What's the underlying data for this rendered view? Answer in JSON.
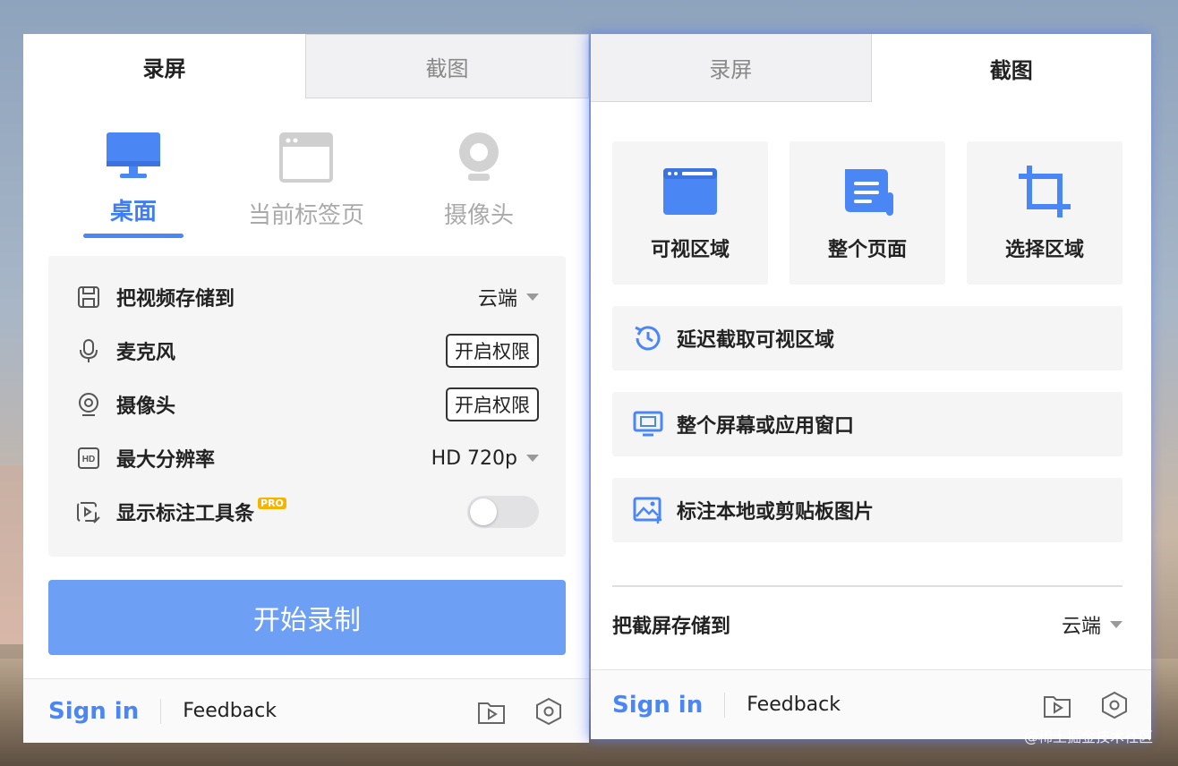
{
  "left_panel": {
    "tabs": [
      {
        "label": "录屏",
        "active": true
      },
      {
        "label": "截图",
        "active": false
      }
    ],
    "modes": [
      {
        "label": "桌面",
        "icon": "monitor-icon",
        "active": true
      },
      {
        "label": "当前标签页",
        "icon": "browser-tab-icon",
        "active": false
      },
      {
        "label": "摄像头",
        "icon": "webcam-icon",
        "active": false
      }
    ],
    "settings": {
      "save_to": {
        "label": "把视频存储到",
        "value": "云端",
        "icon": "floppy-disk-icon"
      },
      "microphone": {
        "label": "麦克风",
        "button": "开启权限",
        "icon": "microphone-icon"
      },
      "camera": {
        "label": "摄像头",
        "button": "开启权限",
        "icon": "webcam-small-icon"
      },
      "resolution": {
        "label": "最大分辨率",
        "value": "HD 720p",
        "icon": "hd-icon"
      },
      "annotation": {
        "label": "显示标注工具条",
        "badge": "PRO",
        "enabled": false,
        "icon": "annotate-video-icon"
      }
    },
    "start_button": "开始录制",
    "footer": {
      "sign_in": "Sign in",
      "feedback": "Feedback"
    }
  },
  "right_panel": {
    "tabs": [
      {
        "label": "录屏",
        "active": false
      },
      {
        "label": "截图",
        "active": true
      }
    ],
    "cards": [
      {
        "label": "可视区域",
        "icon": "visible-area-icon"
      },
      {
        "label": "整个页面",
        "icon": "full-page-scroll-icon"
      },
      {
        "label": "选择区域",
        "icon": "crop-icon"
      }
    ],
    "actions": [
      {
        "label": "延迟截取可视区域",
        "icon": "delay-timer-icon"
      },
      {
        "label": "整个屏幕或应用窗口",
        "icon": "screen-window-icon"
      },
      {
        "label": "标注本地或剪贴板图片",
        "icon": "image-add-icon"
      }
    ],
    "save_to": {
      "label": "把截屏存储到",
      "value": "云端"
    },
    "footer": {
      "sign_in": "Sign in",
      "feedback": "Feedback"
    }
  },
  "colors": {
    "accent": "#4b86f5",
    "start_button": "#6d9ff5",
    "pro_badge": "#f5b400"
  },
  "watermark": "@稀土掘金技术社区"
}
